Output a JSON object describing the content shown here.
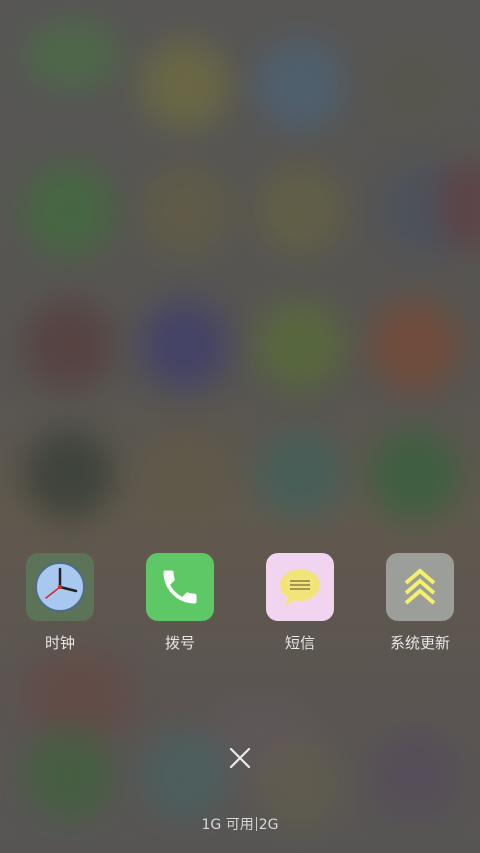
{
  "apps": [
    {
      "label": "时钟",
      "icon": "clock-icon",
      "tile_color": "#5c7358"
    },
    {
      "label": "拨号",
      "icon": "phone-icon",
      "tile_color": "#5dc865"
    },
    {
      "label": "短信",
      "icon": "message-icon",
      "tile_color": "#f1d4ef"
    },
    {
      "label": "系统更新",
      "icon": "system-update-icon",
      "tile_color": "#9b9e99"
    }
  ],
  "close": {
    "icon": "close-icon"
  },
  "memory": {
    "available": "1G 可用",
    "total": "2G"
  }
}
